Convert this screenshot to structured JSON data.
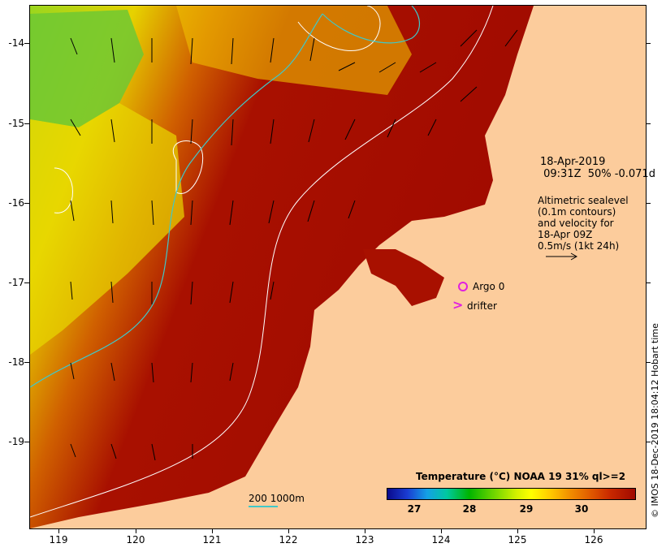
{
  "info": {
    "date_line1": "18-Apr-2019",
    "date_line2": " 09:31Z  50% -0.071d",
    "alt_lines": "Altimetric sealevel\n(0.1m contours)\nand velocity for\n18-Apr 09Z\n0.5m/s (1kt 24h)"
  },
  "credit": "© IMOS 18-Dec-2019 18:04:12 Hobart time",
  "colorbar": {
    "title": "Temperature (°C) NOAA 19 31% ql>=2",
    "ticks": [
      "27",
      "28",
      "29",
      "30"
    ]
  },
  "scale": {
    "label": "200  1000m",
    "color": "#40c8c8"
  },
  "legend": {
    "argo": "Argo 0",
    "drifter": "drifter",
    "marker_color": "#e020e0"
  },
  "axes": {
    "y_labels": [
      "-14",
      "-15",
      "-16",
      "-17",
      "-18",
      "-19"
    ],
    "x_labels": [
      "119",
      "120",
      "121",
      "122",
      "123",
      "124",
      "125",
      "126"
    ]
  },
  "colors": {
    "land": "#fccc9c",
    "warm": "#a00a00",
    "cool": "#64d200",
    "contour": "#ffffff",
    "isobath": "#40c8c8"
  }
}
